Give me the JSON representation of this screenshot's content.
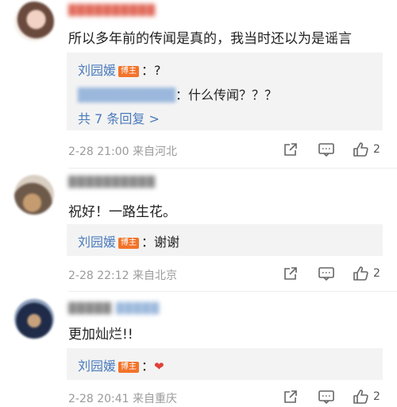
{
  "comments": [
    {
      "text": "所以多年前的传闻是真的，我当时还以为是谣言",
      "reply": {
        "author": "刘园媛",
        "badge": "博主",
        "text": "：?",
        "sub_text": "：什么传闻？？？",
        "more": "共 7 条回复 >"
      },
      "meta": "2-28 21:00  来自河北",
      "likes": "2"
    },
    {
      "text": "祝好！一路生花。",
      "reply": {
        "author": "刘园媛",
        "badge": "博主",
        "text": "：谢谢"
      },
      "meta": "2-28 22:12  来自北京",
      "likes": "2"
    },
    {
      "text": "更加灿烂!!",
      "reply": {
        "author": "刘园媛",
        "badge": "博主",
        "text": "：",
        "emoji": "❤"
      },
      "meta": "2-28 20:41  来自重庆",
      "likes": "2"
    }
  ],
  "colors": {
    "link": "#4b7bbd",
    "badge": "#f2732a",
    "reply_bg": "#f3f3f3",
    "meta": "#9a9a9a"
  },
  "icons": [
    "share-icon",
    "comment-icon",
    "like-icon",
    "heart-emoji"
  ]
}
